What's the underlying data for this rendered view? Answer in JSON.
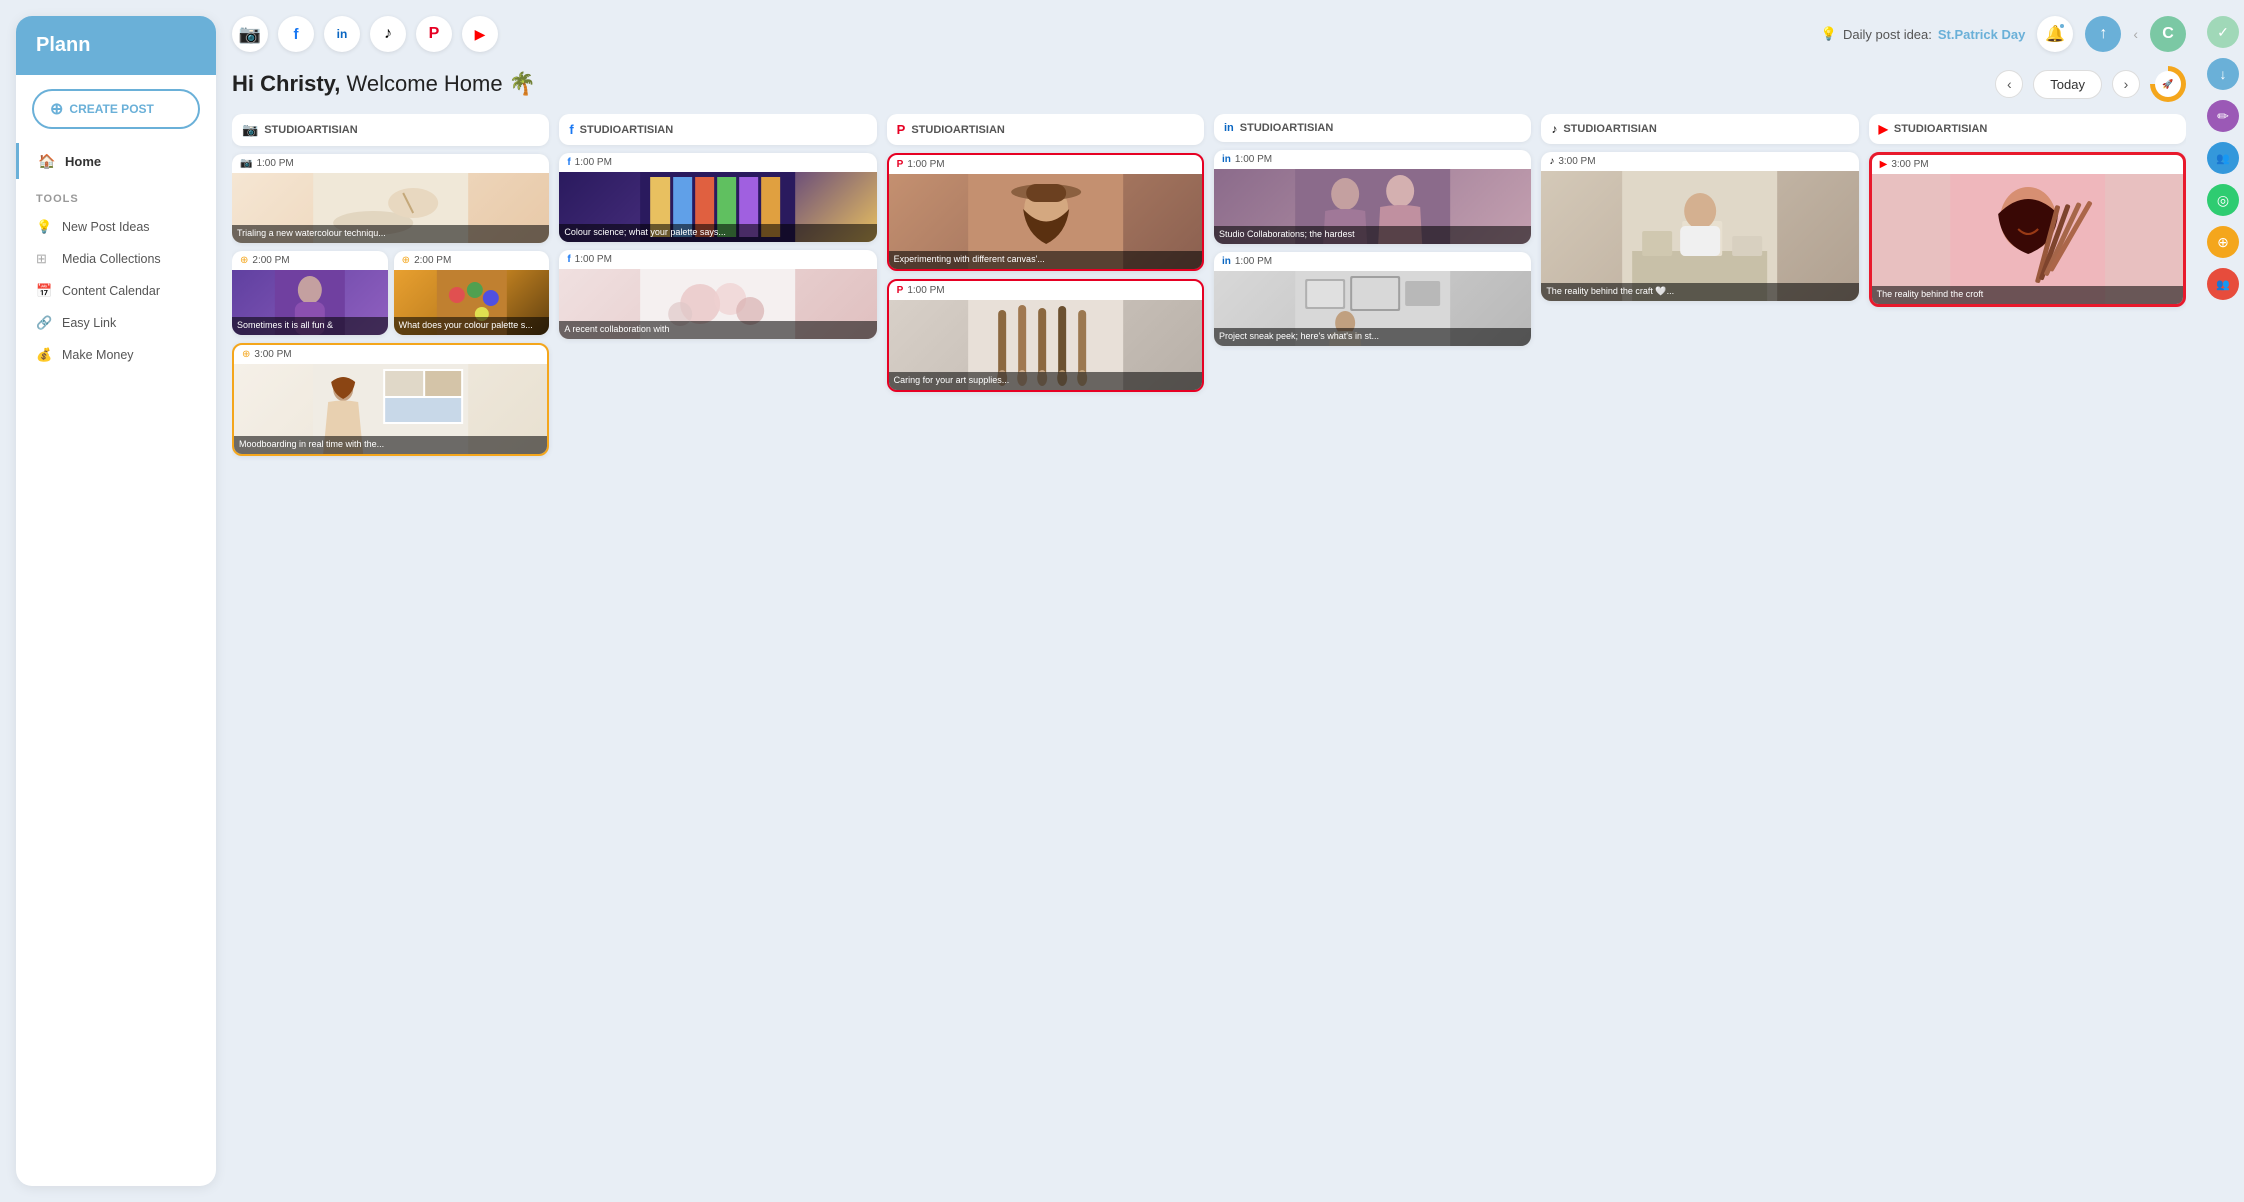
{
  "app": {
    "name": "Plann"
  },
  "sidebar": {
    "create_button": "CREATE POST",
    "nav": [
      {
        "id": "home",
        "label": "Home",
        "active": true
      }
    ],
    "tools_label": "TOOLS",
    "tools": [
      {
        "id": "new-post-ideas",
        "label": "New Post Ideas"
      },
      {
        "id": "media-collections",
        "label": "Media Collections"
      },
      {
        "id": "content-calendar",
        "label": "Content Calendar"
      },
      {
        "id": "easy-link",
        "label": "Easy Link"
      },
      {
        "id": "make-money",
        "label": "Make Money"
      }
    ]
  },
  "topbar": {
    "social_platforms": [
      {
        "id": "instagram",
        "icon": "📷",
        "color": "#c13584"
      },
      {
        "id": "facebook",
        "icon": "f",
        "color": "#1877f2"
      },
      {
        "id": "linkedin",
        "icon": "in",
        "color": "#0a66c2"
      },
      {
        "id": "tiktok",
        "icon": "♪",
        "color": "#000"
      },
      {
        "id": "pinterest",
        "icon": "P",
        "color": "#e60023"
      },
      {
        "id": "youtube",
        "icon": "▶",
        "color": "#ff0000"
      }
    ],
    "daily_post_label": "Daily post idea:",
    "daily_post_link": "St.Patrick Day",
    "today_label": "Today",
    "avatar_letter": "C"
  },
  "welcome": {
    "hi": "Hi Christy,",
    "message": "Welcome Home 🌴"
  },
  "columns": [
    {
      "id": "instagram",
      "platform": "instagram",
      "platform_icon": "📷",
      "handle": "STUDIOARTISIAN",
      "posts": [
        {
          "time": "1:00 PM",
          "caption": "Trialing a new watercolour techniqu...",
          "image_class": "img-watercolor",
          "highlighted": false
        },
        {
          "time": "2:00 PM",
          "caption": "Sometimes it is all fun &",
          "image_class": "img-purple-woman",
          "highlighted": false
        },
        {
          "time": "2:00 PM",
          "caption": "What does your colour palette s...",
          "image_class": "img-palette",
          "highlighted": false
        },
        {
          "time": "3:00 PM",
          "caption": "Moodboarding in real time with the...",
          "image_class": "img-moodboard",
          "highlighted": false
        }
      ]
    },
    {
      "id": "facebook",
      "platform": "facebook",
      "platform_icon": "f",
      "handle": "STUDIOARTISIAN",
      "posts": [
        {
          "time": "1:00 PM",
          "caption": "Colour science; what your palette says...",
          "image_class": "img-paints",
          "highlighted": false
        },
        {
          "time": "1:00 PM",
          "caption": "A recent collaboration with",
          "image_class": "img-flowers",
          "highlighted": false
        }
      ]
    },
    {
      "id": "pinterest",
      "platform": "pinterest",
      "platform_icon": "P",
      "handle": "STUDIOARTISIAN",
      "posts": [
        {
          "time": "1:00 PM",
          "caption": "Experimenting with different canvas'...",
          "image_class": "img-woman-hat",
          "highlighted": false
        },
        {
          "time": "1:00 PM",
          "caption": "Caring for your art supplies...",
          "image_class": "img-brushes",
          "highlighted": false
        }
      ]
    },
    {
      "id": "linkedin",
      "platform": "linkedin",
      "platform_icon": "in",
      "handle": "STUDIOARTISIAN",
      "posts": [
        {
          "time": "1:00 PM",
          "caption": "Studio Collaborations; the hardest",
          "image_class": "img-women-collab",
          "highlighted": false
        },
        {
          "time": "1:00 PM",
          "caption": "Project sneak peek; here's what's in st...",
          "image_class": "img-frames",
          "highlighted": false
        }
      ]
    },
    {
      "id": "tiktok",
      "platform": "tiktok",
      "platform_icon": "♪",
      "handle": "STUDIOARTISIAN",
      "posts": [
        {
          "time": "3:00 PM",
          "caption": "The reality behind the craft 🤍...",
          "image_class": "img-desk",
          "highlighted": false
        }
      ]
    },
    {
      "id": "youtube",
      "platform": "youtube",
      "platform_icon": "▶",
      "handle": "STUDIOARTISIAN",
      "posts": [
        {
          "time": "3:00 PM",
          "caption": "The reality behind the croft",
          "image_class": "img-woman-brushes",
          "highlighted": true
        }
      ]
    }
  ],
  "right_sidebar": {
    "buttons": [
      {
        "id": "check",
        "icon": "✓",
        "color": "#a0d8b8"
      },
      {
        "id": "download",
        "icon": "↓",
        "color": "#6ab0d8"
      },
      {
        "id": "edit",
        "icon": "✏",
        "color": "#9b59b6"
      },
      {
        "id": "users",
        "icon": "👥",
        "color": "#3498db"
      },
      {
        "id": "network",
        "icon": "◎",
        "color": "#2ecc71"
      },
      {
        "id": "coins",
        "icon": "⊕",
        "color": "#f4a61c"
      },
      {
        "id": "group",
        "icon": "⊕",
        "color": "#e74c3c"
      }
    ]
  }
}
